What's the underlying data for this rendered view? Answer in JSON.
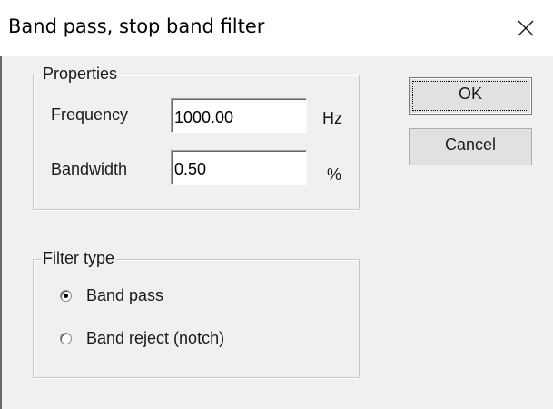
{
  "window": {
    "title": "Band pass, stop band filter",
    "close_icon": "close-icon"
  },
  "properties": {
    "group_label": "Properties",
    "frequency_label": "Frequency",
    "frequency_value": "1000.00",
    "frequency_unit": "Hz",
    "bandwidth_label": "Bandwidth",
    "bandwidth_value": "0.50",
    "bandwidth_unit": "%"
  },
  "filter_type": {
    "group_label": "Filter type",
    "options": [
      {
        "label": "Band pass",
        "checked": true
      },
      {
        "label": "Band reject (notch)",
        "checked": false
      }
    ]
  },
  "buttons": {
    "ok_label": "OK",
    "cancel_label": "Cancel"
  }
}
